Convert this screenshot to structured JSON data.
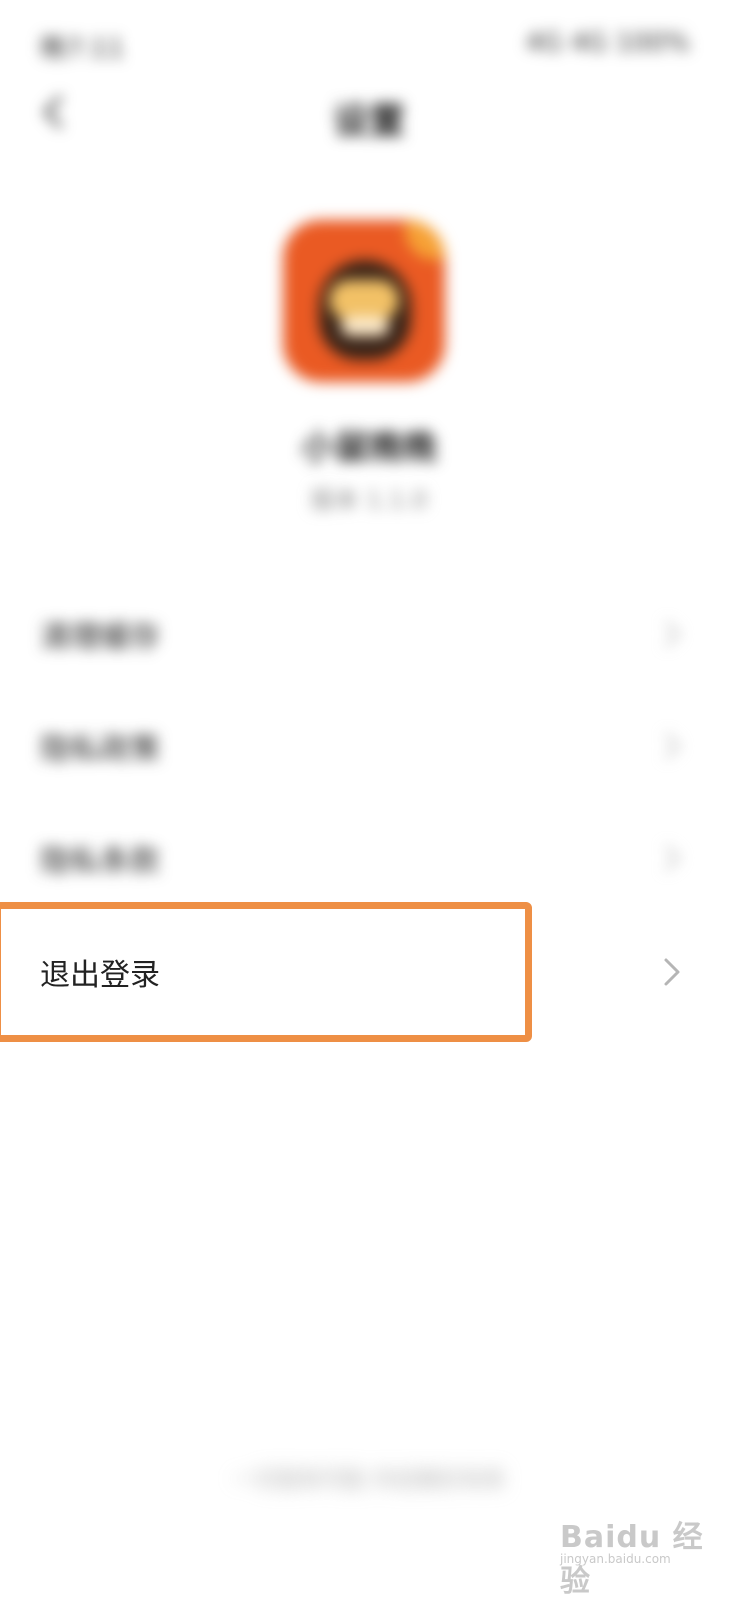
{
  "status_bar": {
    "time": "晚7:11",
    "right": "4G 4G 100%"
  },
  "header": {
    "title": "设置"
  },
  "app": {
    "name": "小鼠晚晚",
    "version": "版本 1.1.0"
  },
  "menu": {
    "items": [
      {
        "label": "清理缓存"
      },
      {
        "label": "隐私政策"
      },
      {
        "label": "隐私条款"
      }
    ],
    "logout_label": "退出登录"
  },
  "footer": {
    "text": "一切皆有可能 共创美好未来"
  },
  "watermark": {
    "text": "Baidu 经验",
    "sub": "jingyan.baidu.com"
  },
  "colors": {
    "highlight": "#ee8f45",
    "app_icon": "#ea5a23"
  }
}
